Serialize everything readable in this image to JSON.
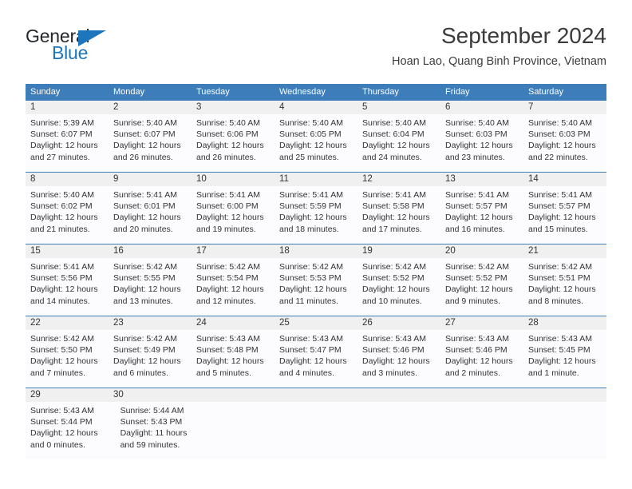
{
  "brand": {
    "name_part1": "General",
    "name_part2": "Blue",
    "triangle_icon": "triangle-icon",
    "color_dark": "#25282b",
    "color_blue": "#1d76bc"
  },
  "header": {
    "title": "September 2024",
    "subtitle": "Hoan Lao, Quang Binh Province, Vietnam"
  },
  "calendar": {
    "accent_color": "#3c7dba",
    "daynumber_band_color": "#f0f0f0",
    "day_headers": [
      "Sunday",
      "Monday",
      "Tuesday",
      "Wednesday",
      "Thursday",
      "Friday",
      "Saturday"
    ],
    "weeks": [
      {
        "days": [
          {
            "num": "1",
            "sunrise": "Sunrise: 5:39 AM",
            "sunset": "Sunset: 6:07 PM",
            "daylight1": "Daylight: 12 hours",
            "daylight2": "and 27 minutes."
          },
          {
            "num": "2",
            "sunrise": "Sunrise: 5:40 AM",
            "sunset": "Sunset: 6:07 PM",
            "daylight1": "Daylight: 12 hours",
            "daylight2": "and 26 minutes."
          },
          {
            "num": "3",
            "sunrise": "Sunrise: 5:40 AM",
            "sunset": "Sunset: 6:06 PM",
            "daylight1": "Daylight: 12 hours",
            "daylight2": "and 26 minutes."
          },
          {
            "num": "4",
            "sunrise": "Sunrise: 5:40 AM",
            "sunset": "Sunset: 6:05 PM",
            "daylight1": "Daylight: 12 hours",
            "daylight2": "and 25 minutes."
          },
          {
            "num": "5",
            "sunrise": "Sunrise: 5:40 AM",
            "sunset": "Sunset: 6:04 PM",
            "daylight1": "Daylight: 12 hours",
            "daylight2": "and 24 minutes."
          },
          {
            "num": "6",
            "sunrise": "Sunrise: 5:40 AM",
            "sunset": "Sunset: 6:03 PM",
            "daylight1": "Daylight: 12 hours",
            "daylight2": "and 23 minutes."
          },
          {
            "num": "7",
            "sunrise": "Sunrise: 5:40 AM",
            "sunset": "Sunset: 6:03 PM",
            "daylight1": "Daylight: 12 hours",
            "daylight2": "and 22 minutes."
          }
        ]
      },
      {
        "days": [
          {
            "num": "8",
            "sunrise": "Sunrise: 5:40 AM",
            "sunset": "Sunset: 6:02 PM",
            "daylight1": "Daylight: 12 hours",
            "daylight2": "and 21 minutes."
          },
          {
            "num": "9",
            "sunrise": "Sunrise: 5:41 AM",
            "sunset": "Sunset: 6:01 PM",
            "daylight1": "Daylight: 12 hours",
            "daylight2": "and 20 minutes."
          },
          {
            "num": "10",
            "sunrise": "Sunrise: 5:41 AM",
            "sunset": "Sunset: 6:00 PM",
            "daylight1": "Daylight: 12 hours",
            "daylight2": "and 19 minutes."
          },
          {
            "num": "11",
            "sunrise": "Sunrise: 5:41 AM",
            "sunset": "Sunset: 5:59 PM",
            "daylight1": "Daylight: 12 hours",
            "daylight2": "and 18 minutes."
          },
          {
            "num": "12",
            "sunrise": "Sunrise: 5:41 AM",
            "sunset": "Sunset: 5:58 PM",
            "daylight1": "Daylight: 12 hours",
            "daylight2": "and 17 minutes."
          },
          {
            "num": "13",
            "sunrise": "Sunrise: 5:41 AM",
            "sunset": "Sunset: 5:57 PM",
            "daylight1": "Daylight: 12 hours",
            "daylight2": "and 16 minutes."
          },
          {
            "num": "14",
            "sunrise": "Sunrise: 5:41 AM",
            "sunset": "Sunset: 5:57 PM",
            "daylight1": "Daylight: 12 hours",
            "daylight2": "and 15 minutes."
          }
        ]
      },
      {
        "days": [
          {
            "num": "15",
            "sunrise": "Sunrise: 5:41 AM",
            "sunset": "Sunset: 5:56 PM",
            "daylight1": "Daylight: 12 hours",
            "daylight2": "and 14 minutes."
          },
          {
            "num": "16",
            "sunrise": "Sunrise: 5:42 AM",
            "sunset": "Sunset: 5:55 PM",
            "daylight1": "Daylight: 12 hours",
            "daylight2": "and 13 minutes."
          },
          {
            "num": "17",
            "sunrise": "Sunrise: 5:42 AM",
            "sunset": "Sunset: 5:54 PM",
            "daylight1": "Daylight: 12 hours",
            "daylight2": "and 12 minutes."
          },
          {
            "num": "18",
            "sunrise": "Sunrise: 5:42 AM",
            "sunset": "Sunset: 5:53 PM",
            "daylight1": "Daylight: 12 hours",
            "daylight2": "and 11 minutes."
          },
          {
            "num": "19",
            "sunrise": "Sunrise: 5:42 AM",
            "sunset": "Sunset: 5:52 PM",
            "daylight1": "Daylight: 12 hours",
            "daylight2": "and 10 minutes."
          },
          {
            "num": "20",
            "sunrise": "Sunrise: 5:42 AM",
            "sunset": "Sunset: 5:52 PM",
            "daylight1": "Daylight: 12 hours",
            "daylight2": "and 9 minutes."
          },
          {
            "num": "21",
            "sunrise": "Sunrise: 5:42 AM",
            "sunset": "Sunset: 5:51 PM",
            "daylight1": "Daylight: 12 hours",
            "daylight2": "and 8 minutes."
          }
        ]
      },
      {
        "days": [
          {
            "num": "22",
            "sunrise": "Sunrise: 5:42 AM",
            "sunset": "Sunset: 5:50 PM",
            "daylight1": "Daylight: 12 hours",
            "daylight2": "and 7 minutes."
          },
          {
            "num": "23",
            "sunrise": "Sunrise: 5:42 AM",
            "sunset": "Sunset: 5:49 PM",
            "daylight1": "Daylight: 12 hours",
            "daylight2": "and 6 minutes."
          },
          {
            "num": "24",
            "sunrise": "Sunrise: 5:43 AM",
            "sunset": "Sunset: 5:48 PM",
            "daylight1": "Daylight: 12 hours",
            "daylight2": "and 5 minutes."
          },
          {
            "num": "25",
            "sunrise": "Sunrise: 5:43 AM",
            "sunset": "Sunset: 5:47 PM",
            "daylight1": "Daylight: 12 hours",
            "daylight2": "and 4 minutes."
          },
          {
            "num": "26",
            "sunrise": "Sunrise: 5:43 AM",
            "sunset": "Sunset: 5:46 PM",
            "daylight1": "Daylight: 12 hours",
            "daylight2": "and 3 minutes."
          },
          {
            "num": "27",
            "sunrise": "Sunrise: 5:43 AM",
            "sunset": "Sunset: 5:46 PM",
            "daylight1": "Daylight: 12 hours",
            "daylight2": "and 2 minutes."
          },
          {
            "num": "28",
            "sunrise": "Sunrise: 5:43 AM",
            "sunset": "Sunset: 5:45 PM",
            "daylight1": "Daylight: 12 hours",
            "daylight2": "and 1 minute."
          }
        ]
      },
      {
        "days": [
          {
            "num": "29",
            "sunrise": "Sunrise: 5:43 AM",
            "sunset": "Sunset: 5:44 PM",
            "daylight1": "Daylight: 12 hours",
            "daylight2": "and 0 minutes."
          },
          {
            "num": "30",
            "sunrise": "Sunrise: 5:44 AM",
            "sunset": "Sunset: 5:43 PM",
            "daylight1": "Daylight: 11 hours",
            "daylight2": "and 59 minutes."
          },
          {
            "num": "",
            "sunrise": "",
            "sunset": "",
            "daylight1": "",
            "daylight2": ""
          },
          {
            "num": "",
            "sunrise": "",
            "sunset": "",
            "daylight1": "",
            "daylight2": ""
          },
          {
            "num": "",
            "sunrise": "",
            "sunset": "",
            "daylight1": "",
            "daylight2": ""
          },
          {
            "num": "",
            "sunrise": "",
            "sunset": "",
            "daylight1": "",
            "daylight2": ""
          },
          {
            "num": "",
            "sunrise": "",
            "sunset": "",
            "daylight1": "",
            "daylight2": ""
          }
        ]
      }
    ]
  }
}
